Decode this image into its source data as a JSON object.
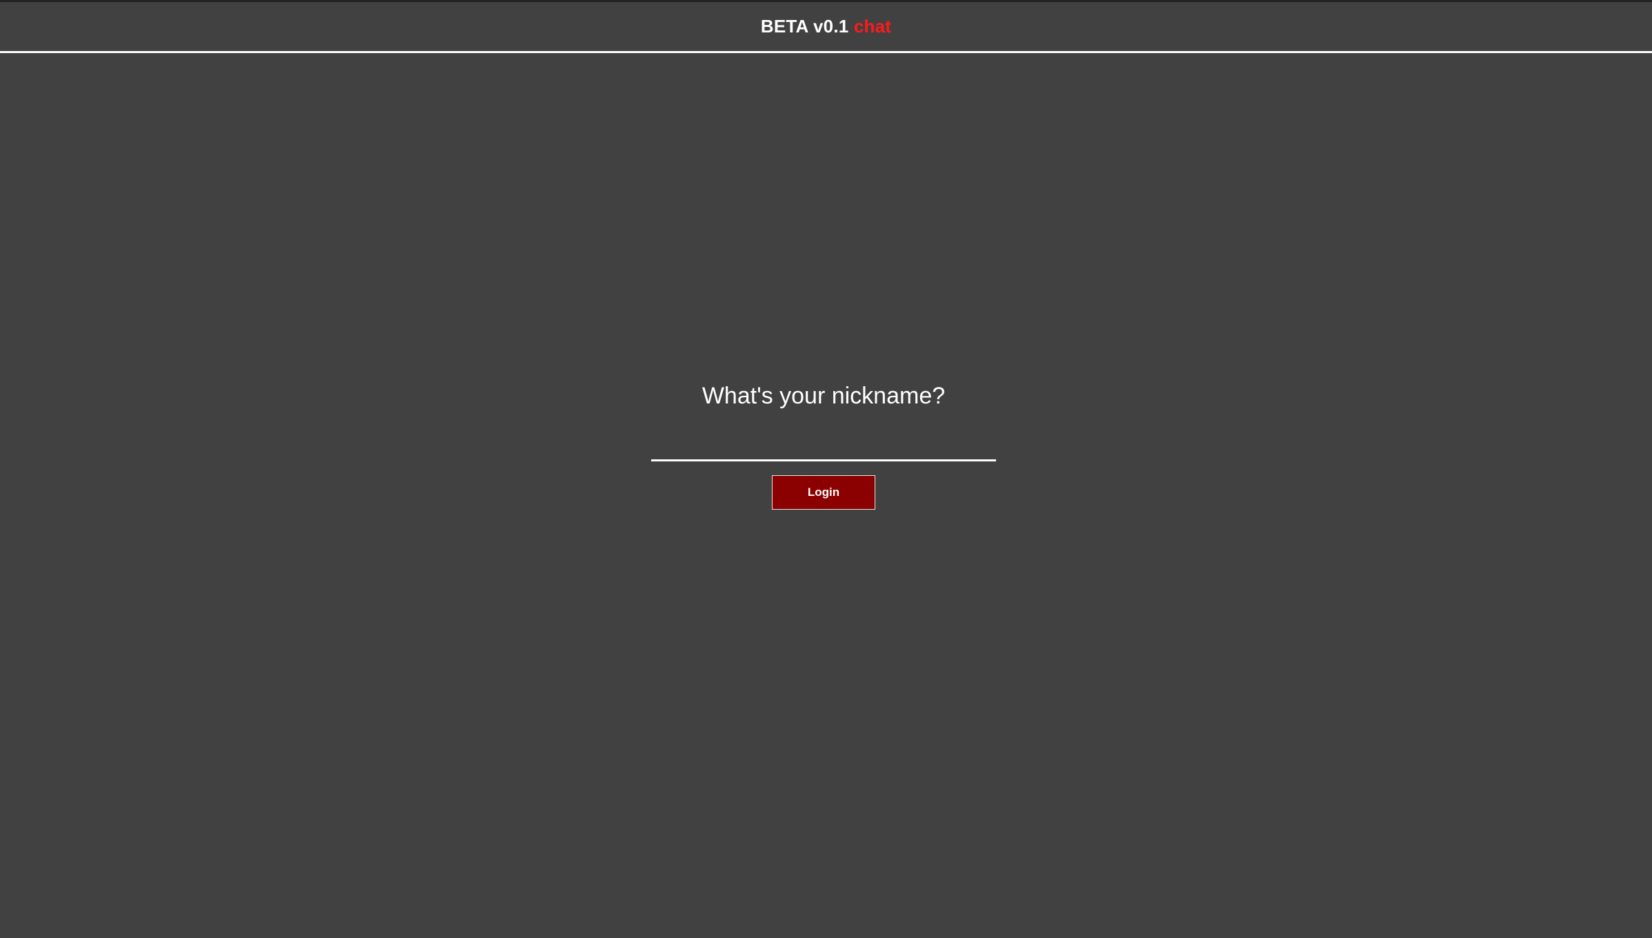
{
  "header": {
    "brand_prefix": "BETA v0.1 ",
    "brand_accent": "chat"
  },
  "login": {
    "prompt": "What's your nickname?",
    "nickname_value": "",
    "nickname_placeholder": "",
    "button_label": "Login"
  },
  "colors": {
    "background": "#414141",
    "accent": "#ff1a1a",
    "button": "#8b0000",
    "text": "#ffffff"
  }
}
